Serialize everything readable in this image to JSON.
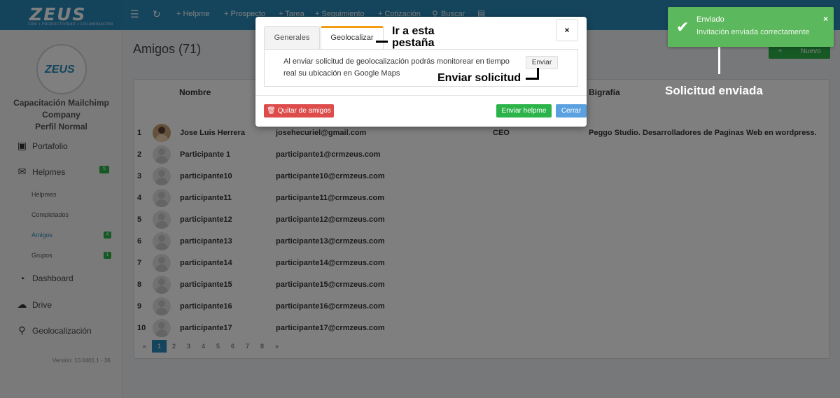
{
  "logo": {
    "word": "ZEUS",
    "sub": "CRM + PRODUCTIVIDAD + COLABORACION"
  },
  "nav": {
    "items": [
      "+ Helpme",
      "+ Prospecto",
      "+ Tarea",
      "+ Seguimiento",
      "+ Cotización",
      "Buscar"
    ],
    "icons": [
      "menu-icon",
      "refresh-icon",
      "search-icon",
      "list-icon"
    ]
  },
  "sidebar": {
    "avatar_word": "ZEUS",
    "company_line1": "Capacitación Mailchimp",
    "company_line2": "Company",
    "profile": "Perfil Normal",
    "items": [
      {
        "label": "Portafolio",
        "icon": "briefcase-icon"
      },
      {
        "label": "Helpmes",
        "icon": "chat-icon",
        "badge": "5"
      },
      {
        "label": "Dashboard",
        "icon": "piechart-icon"
      },
      {
        "label": "Drive",
        "icon": "cloud-icon"
      },
      {
        "label": "Geolocalización",
        "icon": "map-marker-icon"
      }
    ],
    "sub_items": [
      {
        "label": "Helpmes"
      },
      {
        "label": "Completados"
      },
      {
        "label": "Amigos",
        "badge": "4"
      },
      {
        "label": "Grupos",
        "badge": "1"
      }
    ],
    "version": "Versión: 10.0401.1 - 36"
  },
  "main": {
    "title": "Amigos (71)",
    "new_button": "Nuevo",
    "headers": {
      "name": "Nombre",
      "bio": "Bigrafía"
    },
    "rows": [
      {
        "idx": "1",
        "name": "Jose Luis Herrera",
        "email": "josehecuriel@gmail.com",
        "position": "CEO",
        "bio": "Peggo Studio. Desarrolladores de Paginas Web en wordpress."
      },
      {
        "idx": "2",
        "name": "Participante 1",
        "email": "participante1@crmzeus.com",
        "position": "",
        "bio": ""
      },
      {
        "idx": "3",
        "name": "participante10",
        "email": "participante10@crmzeus.com",
        "position": "",
        "bio": ""
      },
      {
        "idx": "4",
        "name": "participante11",
        "email": "participante11@crmzeus.com",
        "position": "",
        "bio": ""
      },
      {
        "idx": "5",
        "name": "participante12",
        "email": "participante12@crmzeus.com",
        "position": "",
        "bio": ""
      },
      {
        "idx": "6",
        "name": "participante13",
        "email": "participante13@crmzeus.com",
        "position": "",
        "bio": ""
      },
      {
        "idx": "7",
        "name": "participante14",
        "email": "participante14@crmzeus.com",
        "position": "",
        "bio": ""
      },
      {
        "idx": "8",
        "name": "participante15",
        "email": "participante15@crmzeus.com",
        "position": "",
        "bio": ""
      },
      {
        "idx": "9",
        "name": "participante16",
        "email": "participante16@crmzeus.com",
        "position": "",
        "bio": ""
      },
      {
        "idx": "10",
        "name": "participante17",
        "email": "participante17@crmzeus.com",
        "position": "",
        "bio": ""
      }
    ],
    "pager": [
      "«",
      "1",
      "2",
      "3",
      "4",
      "5",
      "6",
      "7",
      "8",
      "»"
    ],
    "pager_active": "1"
  },
  "modal": {
    "tabs": [
      {
        "label": "Generales"
      },
      {
        "label": "Geolocalizar"
      }
    ],
    "geo_text": "Al enviar solicitud de geolocalización podrás monitorear en tiempo real su ubicación en Google Maps",
    "send_button": "Enviar",
    "close_symbol": "×",
    "remove_button": "Quitar de amigos",
    "helpme_button": "Enviar helpme",
    "cerrar_button": "Cerrar"
  },
  "annotations": {
    "tab_hint_line1": "Ir a esta",
    "tab_hint_line2": "pestaña",
    "send_hint": "Enviar solicitud",
    "sent_hint": "Solicitud enviada"
  },
  "toast": {
    "title": "Enviado",
    "message": "Invitación enviada correctamente",
    "close_symbol": "×",
    "color": "#5cb85c"
  }
}
